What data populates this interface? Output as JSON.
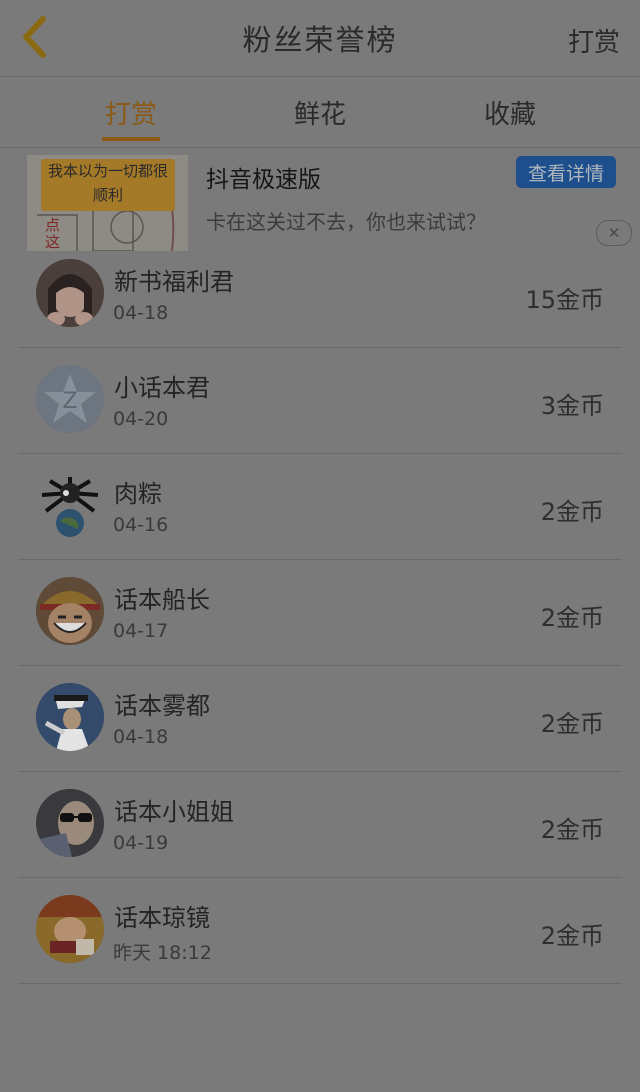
{
  "header": {
    "title": "粉丝荣誉榜",
    "action": "打赏"
  },
  "tabs": [
    {
      "label": "打赏",
      "active": true
    },
    {
      "label": "鲜花",
      "active": false
    },
    {
      "label": "收藏",
      "active": false
    }
  ],
  "ad": {
    "image_caption": "我本以为一切都很 顺利",
    "image_badge": "点这",
    "title": "抖音极速版",
    "description": "卡在这关过不去，你也来试试？",
    "button": "查看详情"
  },
  "fans": [
    {
      "name": "新书福利君",
      "date": "04-18",
      "amount": "15金币",
      "avatar": "girl-avatar"
    },
    {
      "name": "小话本君",
      "date": "04-20",
      "amount": "3金币",
      "avatar": "star-logo-avatar"
    },
    {
      "name": "肉粽",
      "date": "04-16",
      "amount": "2金币",
      "avatar": "cartoon-globe-avatar"
    },
    {
      "name": "话本船长",
      "date": "04-17",
      "amount": "2金币",
      "avatar": "pirate-avatar"
    },
    {
      "name": "话本雾都",
      "date": "04-18",
      "amount": "2金币",
      "avatar": "dancer-avatar"
    },
    {
      "name": "话本小姐姐",
      "date": "04-19",
      "amount": "2金币",
      "avatar": "sunglasses-avatar"
    },
    {
      "name": "话本琼镜",
      "date": "昨天 18:12",
      "amount": "2金币",
      "avatar": "comic-avatar"
    }
  ]
}
